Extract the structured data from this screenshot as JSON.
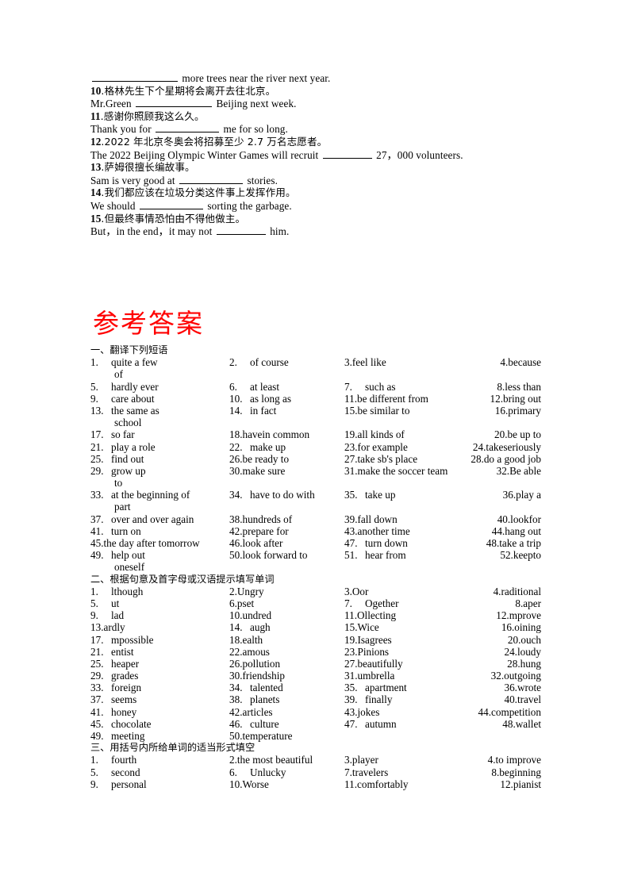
{
  "document": {
    "title": "参考答案",
    "title_color": "#FF0000"
  },
  "exercise": {
    "lines": [
      {
        "type": "en",
        "pre": "",
        "blank": "lg",
        "post": " more trees near the river next year."
      },
      {
        "type": "cn",
        "num": "10",
        "text": ".格林先生下个星期将会离开去往北京。"
      },
      {
        "type": "en",
        "pre": "Mr.Green ",
        "blank": "md",
        "post": " Beijing next week."
      },
      {
        "type": "cn",
        "num": "11",
        "text": ".感谢你照顾我这么久。"
      },
      {
        "type": "en",
        "pre": "Thank you for ",
        "blank": "sm",
        "post": " me for so long."
      },
      {
        "type": "cn",
        "num": "12",
        "text": ".2022 年北京冬奥会将招募至少 2.7 万名志愿者。"
      },
      {
        "type": "en",
        "pre": "The 2022 Beijing Olympic Winter Games will recruit ",
        "blank": "xs",
        "post": " 27，000 volunteers."
      },
      {
        "type": "cn",
        "num": "13",
        "text": ".萨姆很擅长编故事。"
      },
      {
        "type": "en",
        "pre": "Sam is very good at   ",
        "blank": "sm",
        "post": " stories."
      },
      {
        "type": "cn",
        "num": "14",
        "text": ".我们都应该在垃圾分类这件事上发挥作用。"
      },
      {
        "type": "en",
        "pre": "We should ",
        "blank": "sm",
        "post": " sorting the garbage."
      },
      {
        "type": "cn",
        "num": "15",
        "text": ".但最终事情恐怕由不得他做主。"
      },
      {
        "type": "en",
        "pre": "But，in the end，it may not    ",
        "blank": "xs",
        "post": " him."
      }
    ]
  },
  "sections": [
    {
      "heading": "一、翻译下列短语",
      "rows": [
        {
          "cells": [
            {
              "n": "1.",
              "t": "quite a few"
            },
            {
              "n": "2.",
              "t": "of course"
            },
            {
              "n": "3.",
              "t": "feel like",
              "tight": true
            },
            {
              "n": "4.",
              "t": "because",
              "tight": true
            }
          ]
        },
        {
          "cont": "of"
        },
        {
          "cells": [
            {
              "n": "5.",
              "t": "hardly ever"
            },
            {
              "n": "6.",
              "t": "at least"
            },
            {
              "n": "7.",
              "t": "such as"
            },
            {
              "n": "8.",
              "t": "less than",
              "tight": true
            }
          ]
        },
        {
          "cells": [
            {
              "n": "9.",
              "t": "care about"
            },
            {
              "n": "10.",
              "t": "as long as"
            },
            {
              "n": "11.",
              "t": "be different from",
              "tight": true
            },
            {
              "n": "12.",
              "t": "bring out",
              "tight": true,
              "wide": true
            }
          ]
        },
        {
          "cells": [
            {
              "n": "13.",
              "t": "the same as"
            },
            {
              "n": "14.",
              "t": "in fact"
            },
            {
              "n": "15.",
              "t": "be similar to",
              "tight": true
            },
            {
              "n": "16.",
              "t": "primary",
              "tight": true
            }
          ]
        },
        {
          "cont": "school"
        },
        {
          "cells": [
            {
              "n": "17.",
              "t": "so far"
            },
            {
              "n": "18.",
              "t": "havein common",
              "tight": true
            },
            {
              "n": "19.",
              "t": "all kinds of",
              "tight": true
            },
            {
              "n": "20.",
              "t": "be up to",
              "tight": true
            }
          ]
        },
        {
          "cells": [
            {
              "n": "21.",
              "t": "play a role"
            },
            {
              "n": "22.",
              "t": "make up"
            },
            {
              "n": "23.",
              "t": "for example",
              "tight": true
            },
            {
              "n": "24.",
              "t": "takeseriously",
              "tight": true,
              "wide": true
            }
          ]
        },
        {
          "cells": [
            {
              "n": "25.",
              "t": "find out"
            },
            {
              "n": "26.",
              "t": "be ready to",
              "tight": true
            },
            {
              "n": "27.",
              "t": "take sb's place",
              "tight": true
            },
            {
              "n": "28.",
              "t": "do a good job",
              "tight": true,
              "wide": true
            }
          ]
        },
        {
          "cells": [
            {
              "n": "29.",
              "t": "grow up"
            },
            {
              "n": "30.",
              "t": "make sure",
              "tight": true
            },
            {
              "n": "31.",
              "t": "make the soccer team",
              "tight": true
            },
            {
              "n": "32.",
              "t": "Be   able",
              "tight": true
            }
          ]
        },
        {
          "cont": "to"
        },
        {
          "cells": [
            {
              "n": "33.",
              "t": "at the beginning of"
            },
            {
              "n": "34.",
              "t": "have to do with"
            },
            {
              "n": "35.",
              "t": "take up"
            },
            {
              "n": "36.",
              "t": "play    a",
              "tight": true
            }
          ]
        },
        {
          "cont": "part"
        },
        {
          "cells": [
            {
              "n": "37.",
              "t": "over and over again"
            },
            {
              "n": "38.",
              "t": "hundreds of",
              "tight": true
            },
            {
              "n": "39.",
              "t": "fall down",
              "tight": true
            },
            {
              "n": "40.",
              "t": "lookfor",
              "tight": true
            }
          ]
        },
        {
          "cells": [
            {
              "n": "41.",
              "t": "turn on"
            },
            {
              "n": "42.",
              "t": "prepare for",
              "tight": true
            },
            {
              "n": "43.",
              "t": "another time",
              "tight": true
            },
            {
              "n": "44.",
              "t": "hang out"
            }
          ]
        },
        {
          "cells": [
            {
              "n": "45.",
              "t": "the day after tomorrow",
              "tight": true
            },
            {
              "n": "46.",
              "t": "look after",
              "tight": true
            },
            {
              "n": "47.",
              "t": "turn down"
            },
            {
              "n": "48.",
              "t": "take a trip",
              "tight": true,
              "wide": true
            }
          ]
        },
        {
          "cells": [
            {
              "n": "49.",
              "t": "help out"
            },
            {
              "n": "50.",
              "t": "look forward to",
              "tight": true
            },
            {
              "n": "51.",
              "t": "hear from"
            },
            {
              "n": "52.",
              "t": "keepto",
              "tight": true
            }
          ]
        },
        {
          "cont": "oneself"
        }
      ]
    },
    {
      "heading": "二、根据句意及首字母或汉语提示填写单词",
      "rows": [
        {
          "cells": [
            {
              "n": "1.",
              "t": "lthough"
            },
            {
              "n": "2.",
              "t": "Ungry",
              "tight": true
            },
            {
              "n": "3.",
              "t": "Oor",
              "tight": true
            },
            {
              "n": "4.",
              "t": "raditional",
              "tight": true,
              "wide": true
            }
          ]
        },
        {
          "cells": [
            {
              "n": "5.",
              "t": "ut"
            },
            {
              "n": "6.",
              "t": "pset",
              "tight": true
            },
            {
              "n": "7.",
              "t": "Ogether"
            },
            {
              "n": "8.",
              "t": "aper"
            }
          ]
        },
        {
          "cells": [
            {
              "n": "9.",
              "t": "lad"
            },
            {
              "n": "10.",
              "t": "undred",
              "tight": true
            },
            {
              "n": "11.",
              "t": "Ollecting",
              "tight": true
            },
            {
              "n": "12.",
              "t": "mprove",
              "tight": true
            }
          ]
        },
        {
          "cells": [
            {
              "n": "13.",
              "t": "ardly",
              "tight": true
            },
            {
              "n": "14.",
              "t": "augh"
            },
            {
              "n": "15.",
              "t": "Wice",
              "tight": true
            },
            {
              "n": "16.",
              "t": "oining"
            }
          ]
        },
        {
          "cells": [
            {
              "n": "17.",
              "t": "mpossible"
            },
            {
              "n": "18.",
              "t": "ealth",
              "tight": true
            },
            {
              "n": "19.",
              "t": "Isagrees",
              "tight": true
            },
            {
              "n": "20.",
              "t": "ouch",
              "tight": true
            }
          ]
        },
        {
          "cells": [
            {
              "n": "21.",
              "t": "entist"
            },
            {
              "n": "22.",
              "t": "amous",
              "tight": true
            },
            {
              "n": "23.",
              "t": "Pinions",
              "tight": true
            },
            {
              "n": "24.",
              "t": "loudy",
              "tight": true
            }
          ]
        },
        {
          "cells": [
            {
              "n": "25.",
              "t": "heaper"
            },
            {
              "n": "26.",
              "t": "pollution",
              "tight": true
            },
            {
              "n": "27.",
              "t": "beautifully",
              "tight": true
            },
            {
              "n": "28.",
              "t": "hung",
              "tight": true
            }
          ]
        },
        {
          "cells": [
            {
              "n": "29.",
              "t": "grades"
            },
            {
              "n": "30.",
              "t": "friendship",
              "tight": true
            },
            {
              "n": "31.",
              "t": "umbrella",
              "tight": true
            },
            {
              "n": "32.",
              "t": "outgoing",
              "tight": true,
              "wide": true
            }
          ]
        },
        {
          "cells": [
            {
              "n": "33.",
              "t": "foreign"
            },
            {
              "n": "34.",
              "t": "talented"
            },
            {
              "n": "35.",
              "t": "apartment"
            },
            {
              "n": "36.",
              "t": "wrote"
            }
          ]
        },
        {
          "cells": [
            {
              "n": "37.",
              "t": "seems"
            },
            {
              "n": "38.",
              "t": "planets"
            },
            {
              "n": "39.",
              "t": "finally"
            },
            {
              "n": "40.",
              "t": "travel",
              "tight": true
            }
          ]
        },
        {
          "cells": [
            {
              "n": "41.",
              "t": "honey"
            },
            {
              "n": "42.",
              "t": "articles",
              "tight": true
            },
            {
              "n": "43.",
              "t": "jokes",
              "tight": true
            },
            {
              "n": "44.",
              "t": "competition",
              "tight": true,
              "wide": true
            }
          ]
        },
        {
          "cells": [
            {
              "n": "45.",
              "t": "chocolate"
            },
            {
              "n": "46.",
              "t": "culture"
            },
            {
              "n": "47.",
              "t": "autumn"
            },
            {
              "n": "48.",
              "t": "wallet"
            }
          ]
        },
        {
          "cells": [
            {
              "n": "49.",
              "t": "meeting"
            },
            {
              "n": "50.",
              "t": "temperature",
              "tight": true
            },
            {
              "n": "",
              "t": ""
            },
            {
              "n": "",
              "t": ""
            }
          ]
        }
      ]
    },
    {
      "heading": "三、用括号内所给单词的适当形式填空",
      "rows": [
        {
          "cells": [
            {
              "n": "1.",
              "t": "fourth"
            },
            {
              "n": "2.",
              "t": "the most beautiful",
              "tight": true
            },
            {
              "n": "3.",
              "t": "player",
              "tight": true
            },
            {
              "n": "4.",
              "t": "to improve",
              "tight": true,
              "wide": true
            }
          ]
        },
        {
          "cells": [
            {
              "n": "5.",
              "t": "second"
            },
            {
              "n": "6.",
              "t": "Unlucky"
            },
            {
              "n": "7.",
              "t": "travelers",
              "tight": true
            },
            {
              "n": "8.",
              "t": "beginning",
              "tight": true
            }
          ]
        },
        {
          "cells": [
            {
              "n": "9.",
              "t": "personal"
            },
            {
              "n": "10.",
              "t": "Worse",
              "tight": true
            },
            {
              "n": "11.",
              "t": "comfortably",
              "tight": true
            },
            {
              "n": "12.",
              "t": "pianist",
              "tight": true
            }
          ]
        }
      ]
    }
  ]
}
